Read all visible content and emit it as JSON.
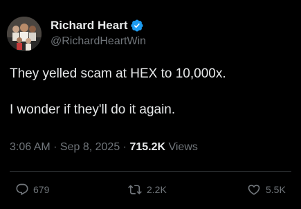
{
  "author": {
    "display_name": "Richard Heart",
    "handle": "@RichardHeartWin",
    "avatar_icon": "group-photo-avatar",
    "verified_icon": "verified-badge-icon",
    "verified_color": "#1d9bf0"
  },
  "tweet": {
    "line1": "They yelled scam at HEX to 10,000x.",
    "line2": "I wonder if they'll do it again."
  },
  "meta": {
    "time": "3:06 AM",
    "sep1": " · ",
    "date": "Sep 8, 2025",
    "sep2": " · ",
    "views_count": "715.2K",
    "views_label": " Views"
  },
  "actions": {
    "reply_icon": "reply-bubble-icon",
    "reply_count": "679",
    "retweet_icon": "retweet-icon",
    "retweet_count": "2.2K",
    "like_icon": "heart-icon",
    "like_count": "5.5K"
  },
  "colors": {
    "background": "#000000",
    "text": "#e7e9ea",
    "secondary_text": "#71767b",
    "divider": "#2f3336"
  }
}
